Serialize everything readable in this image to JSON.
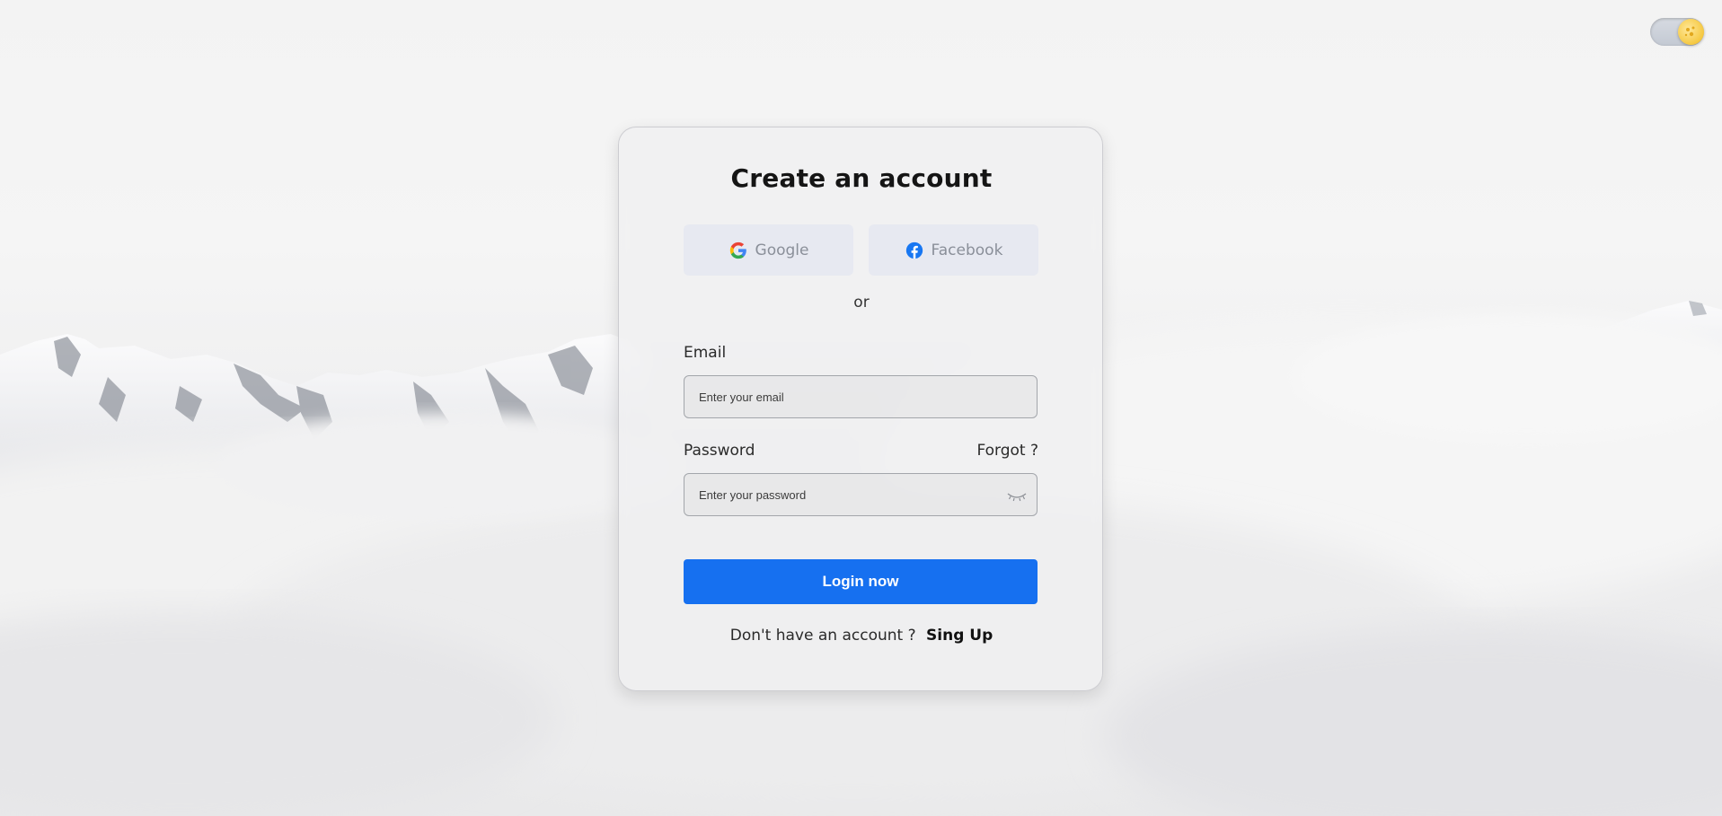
{
  "page": {
    "title": "Create an account"
  },
  "social": {
    "google_label": "Google",
    "facebook_label": "Facebook",
    "google_icon": "google-icon",
    "facebook_icon": "facebook-icon"
  },
  "divider_text": "or",
  "form": {
    "email_label": "Email",
    "email_placeholder": "Enter your email",
    "email_value": "",
    "password_label": "Password",
    "forgot_label": "Forgot ?",
    "password_placeholder": "Enter your password",
    "password_value": "",
    "eye_icon": "eye-closed-icon",
    "submit_label": "Login now"
  },
  "footer": {
    "prompt": "Don't have an account ?",
    "signup_label": "Sing Up"
  },
  "theme_toggle": {
    "icon": "sun-icon",
    "state": "light"
  },
  "colors": {
    "primary": "#1670f0",
    "social_bg": "#e7e9f1",
    "facebook_blue": "#1877f2"
  }
}
